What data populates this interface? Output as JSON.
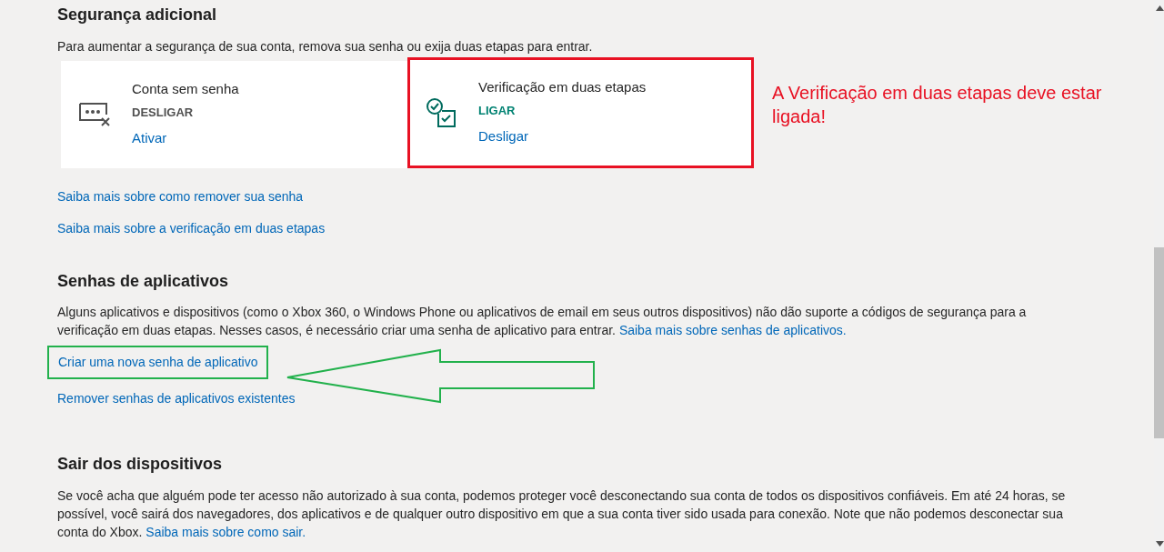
{
  "sections": [
    {
      "title": "Segurança adicional",
      "description": "Para aumentar a segurança de sua conta, remova sua senha ou exija duas etapas para entrar.",
      "cards": [
        {
          "kind": "passwordless",
          "title": "Conta sem senha",
          "status": "DESLIGAR",
          "on": false,
          "action": "Ativar",
          "highlighted": false
        },
        {
          "kind": "two-step",
          "title": "Verificação em duas etapas",
          "status": "LIGAR",
          "on": true,
          "action": "Desligar",
          "highlighted": true
        }
      ],
      "annotation": "A Verificação em duas etapas deve estar ligada!",
      "links": [
        {
          "label": "Saiba mais sobre como remover sua senha",
          "highlighted": false
        },
        {
          "label": "Saiba mais sobre a verificação em duas etapas",
          "highlighted": false
        }
      ]
    },
    {
      "title": "Senhas de aplicativos",
      "description": "Alguns aplicativos e dispositivos (como o Xbox 360, o Windows Phone ou aplicativos de email em seus outros dispositivos) não dão suporte a códigos de segurança para a verificação em duas etapas. Nesses casos, é necessário criar uma senha de aplicativo para entrar.",
      "description_link": "Saiba mais sobre senhas de aplicativos.",
      "links": [
        {
          "label": "Criar uma nova senha de aplicativo",
          "highlighted": true
        },
        {
          "label": "Remover senhas de aplicativos existentes",
          "highlighted": false
        }
      ]
    },
    {
      "title": "Sair dos dispositivos",
      "description": "Se você acha que alguém pode ter acesso não autorizado à sua conta, podemos proteger você desconectando sua conta de todos os dispositivos confiáveis. Em até 24 horas, se possível, você sairá dos navegadores, dos aplicativos e de qualquer outro dispositivo em que a sua conta tiver sido usada para conexão. Note que não podemos desconectar sua conta do Xbox.",
      "description_link": "Saiba mais sobre como sair."
    }
  ]
}
